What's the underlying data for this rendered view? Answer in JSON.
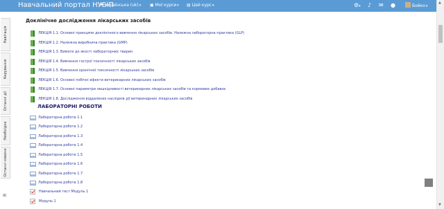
{
  "header": {
    "title": "Навчальний портал НУБіП",
    "language": "Українська (uk)",
    "my_courses": "Мої курси",
    "this_course": "Цей курс",
    "user_name": "Бойко"
  },
  "side_tabs": [
    "Навігація",
    "Керування",
    "Останні дії",
    "Необхідне",
    "Останні новини"
  ],
  "content": {
    "section_title": "Доклінічне дослідження лікарських засобів",
    "lectures": [
      "ЛЕКЦІЯ 1.1. Основні принципи доклінічного вивчення лікарських засобів. Належна лабораторна практика (GLP)",
      "ЛЕКЦІЯ 1.2. Належна виробнича практика (GMP)",
      "ЛЕКЦІЯ 1.3. Вимоги до якості лабораторних тварин",
      "ЛЕКЦІЯ 1.4. Вивчення гострої токсичності лікарських засобів",
      "ЛЕКЦІЯ 1.5. Вивчення хронічної токсичності лікарських засобів",
      "ЛЕКЦІЯ 1.6. Основні побічні ефекти ветеринарних лікарських засобів",
      "ЛЕКЦІЯ 1.7. Основні параметри нешкідливості ветеринарних лікарських засобів та кормових добавок",
      "ЛЕКЦІЯ 1.8. Дослідження віддалених наслідків дії ветеринарних лікарських засобів"
    ],
    "labs_heading": "ЛАБОРАТОРНІ РОБОТИ",
    "labs": [
      "Лабораторна робота 1.1",
      "Лабораторна робота 1.2",
      "Лабораторна робота 1.3",
      "Лабораторна робота 1.4",
      "Лабораторна робота 1.5",
      "Лабораторна робота 1.6",
      "Лабораторна робота 1.7",
      "Лабораторна робота 1.8"
    ],
    "quizzes": [
      "Навчальний тест Модуль 1",
      "Модуль 1"
    ]
  }
}
